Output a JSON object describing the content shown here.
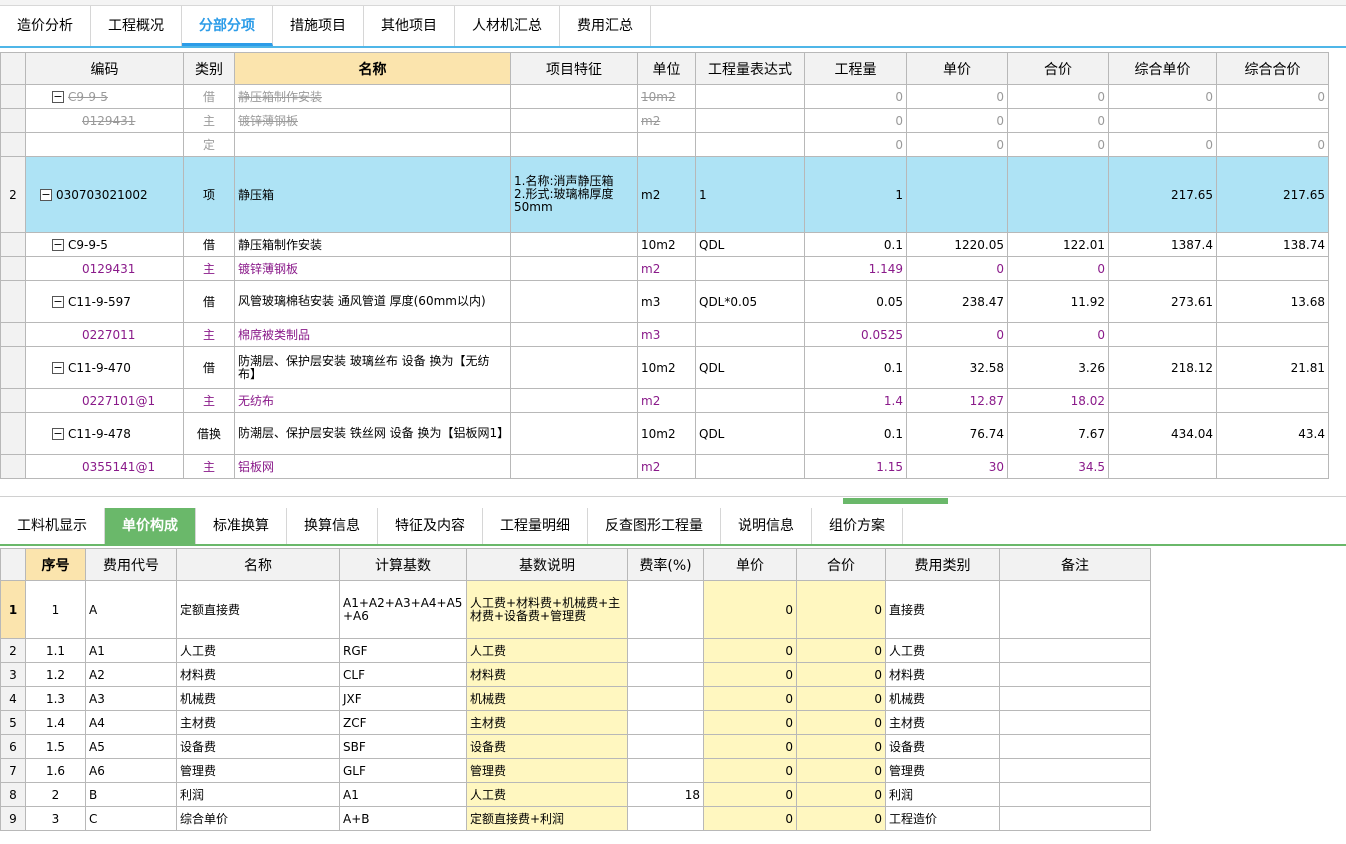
{
  "top_tabs": [
    "造价分析",
    "工程概况",
    "分部分项",
    "措施项目",
    "其他项目",
    "人材机汇总",
    "费用汇总"
  ],
  "main_headers": [
    "编码",
    "类别",
    "名称",
    "项目特征",
    "单位",
    "工程量表达式",
    "工程量",
    "单价",
    "合价",
    "综合单价",
    "综合合价"
  ],
  "main_rows": [
    {
      "rn": "",
      "code": "C9-9-5",
      "type": "借",
      "name": "静压箱制作安装",
      "feature": "",
      "unit": "10m2",
      "expr": "",
      "qty": "0",
      "price": "0",
      "total": "0",
      "cprice": "0",
      "ctotal": "0"
    },
    {
      "rn": "",
      "code": "0129431",
      "type": "主",
      "name": "镀锌薄钢板",
      "feature": "",
      "unit": "m2",
      "expr": "",
      "qty": "0",
      "price": "0",
      "total": "0",
      "cprice": "",
      "ctotal": ""
    },
    {
      "rn": "",
      "code": "",
      "type": "定",
      "name": "",
      "feature": "",
      "unit": "",
      "expr": "",
      "qty": "0",
      "price": "0",
      "total": "0",
      "cprice": "0",
      "ctotal": "0"
    },
    {
      "rn": "2",
      "code": "030703021002",
      "type": "项",
      "name": "静压箱",
      "feature": "1.名称:消声静压箱\n2.形式:玻璃棉厚度50mm",
      "unit": "m2",
      "expr": "1",
      "qty": "1",
      "price": "",
      "total": "",
      "cprice": "217.65",
      "ctotal": "217.65"
    },
    {
      "rn": "",
      "code": "C9-9-5",
      "type": "借",
      "name": "静压箱制作安装",
      "feature": "",
      "unit": "10m2",
      "expr": "QDL",
      "qty": "0.1",
      "price": "1220.05",
      "total": "122.01",
      "cprice": "1387.4",
      "ctotal": "138.74"
    },
    {
      "rn": "",
      "code": "0129431",
      "type": "主",
      "name": "镀锌薄钢板",
      "feature": "",
      "unit": "m2",
      "expr": "",
      "qty": "1.149",
      "price": "0",
      "total": "0",
      "cprice": "",
      "ctotal": ""
    },
    {
      "rn": "",
      "code": "C11-9-597",
      "type": "借",
      "name": "风管玻璃棉毡安装 通风管道 厚度(60mm以内)",
      "feature": "",
      "unit": "m3",
      "expr": "QDL*0.05",
      "qty": "0.05",
      "price": "238.47",
      "total": "11.92",
      "cprice": "273.61",
      "ctotal": "13.68"
    },
    {
      "rn": "",
      "code": "0227011",
      "type": "主",
      "name": "棉席被类制品",
      "feature": "",
      "unit": "m3",
      "expr": "",
      "qty": "0.0525",
      "price": "0",
      "total": "0",
      "cprice": "",
      "ctotal": ""
    },
    {
      "rn": "",
      "code": "C11-9-470",
      "type": "借",
      "name": "防潮层、保护层安装 玻璃丝布 设备  换为【无纺布】",
      "feature": "",
      "unit": "10m2",
      "expr": "QDL",
      "qty": "0.1",
      "price": "32.58",
      "total": "3.26",
      "cprice": "218.12",
      "ctotal": "21.81"
    },
    {
      "rn": "",
      "code": "0227101@1",
      "type": "主",
      "name": "无纺布",
      "feature": "",
      "unit": "m2",
      "expr": "",
      "qty": "1.4",
      "price": "12.87",
      "total": "18.02",
      "cprice": "",
      "ctotal": ""
    },
    {
      "rn": "",
      "code": "C11-9-478",
      "type": "借换",
      "name": "防潮层、保护层安装 铁丝网 设备  换为【铝板网1】",
      "feature": "",
      "unit": "10m2",
      "expr": "QDL",
      "qty": "0.1",
      "price": "76.74",
      "total": "7.67",
      "cprice": "434.04",
      "ctotal": "43.4"
    },
    {
      "rn": "",
      "code": "0355141@1",
      "type": "主",
      "name": "铝板网",
      "feature": "",
      "unit": "m2",
      "expr": "",
      "qty": "1.15",
      "price": "30",
      "total": "34.5",
      "cprice": "",
      "ctotal": ""
    }
  ],
  "bottom_tabs": [
    "工料机显示",
    "单价构成",
    "标准换算",
    "换算信息",
    "特征及内容",
    "工程量明细",
    "反查图形工程量",
    "说明信息",
    "组价方案"
  ],
  "sub_headers": [
    "序号",
    "费用代号",
    "名称",
    "计算基数",
    "基数说明",
    "费率(%)",
    "单价",
    "合价",
    "费用类别",
    "备注"
  ],
  "sub_rows": [
    {
      "rn": "1",
      "seq": "1",
      "code": "A",
      "name": "定额直接费",
      "base": "A1+A2+A3+A4+A5+A6",
      "desc": "人工费+材料费+机械费+主材费+设备费+管理费",
      "rate": "",
      "price": "0",
      "total": "0",
      "cat": "直接费",
      "note": ""
    },
    {
      "rn": "2",
      "seq": "1.1",
      "code": "A1",
      "name": "人工费",
      "base": "RGF",
      "desc": "人工费",
      "rate": "",
      "price": "0",
      "total": "0",
      "cat": "人工费",
      "note": ""
    },
    {
      "rn": "3",
      "seq": "1.2",
      "code": "A2",
      "name": "材料费",
      "base": "CLF",
      "desc": "材料费",
      "rate": "",
      "price": "0",
      "total": "0",
      "cat": "材料费",
      "note": ""
    },
    {
      "rn": "4",
      "seq": "1.3",
      "code": "A3",
      "name": "机械费",
      "base": "JXF",
      "desc": "机械费",
      "rate": "",
      "price": "0",
      "total": "0",
      "cat": "机械费",
      "note": ""
    },
    {
      "rn": "5",
      "seq": "1.4",
      "code": "A4",
      "name": "主材费",
      "base": "ZCF",
      "desc": "主材费",
      "rate": "",
      "price": "0",
      "total": "0",
      "cat": "主材费",
      "note": ""
    },
    {
      "rn": "6",
      "seq": "1.5",
      "code": "A5",
      "name": "设备费",
      "base": "SBF",
      "desc": "设备费",
      "rate": "",
      "price": "0",
      "total": "0",
      "cat": "设备费",
      "note": ""
    },
    {
      "rn": "7",
      "seq": "1.6",
      "code": "A6",
      "name": "管理费",
      "base": "GLF",
      "desc": "管理费",
      "rate": "",
      "price": "0",
      "total": "0",
      "cat": "管理费",
      "note": ""
    },
    {
      "rn": "8",
      "seq": "2",
      "code": "B",
      "name": "利润",
      "base": "A1",
      "desc": "人工费",
      "rate": "18",
      "price": "0",
      "total": "0",
      "cat": "利润",
      "note": ""
    },
    {
      "rn": "9",
      "seq": "3",
      "code": "C",
      "name": "综合单价",
      "base": "A+B",
      "desc": "定额直接费+利润",
      "rate": "",
      "price": "0",
      "total": "0",
      "cat": "工程造价",
      "note": ""
    }
  ],
  "colors": {
    "accent": "#2c9ce8",
    "selected_row": "#aee3f5",
    "main_material": "#8a1a8a",
    "active_bottom_tab": "#6ab86a",
    "header_highlight": "#fbe4ad"
  }
}
